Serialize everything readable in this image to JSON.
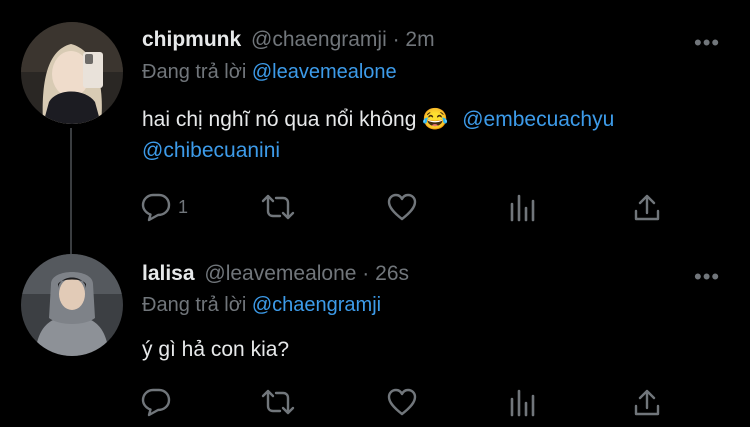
{
  "tweets": [
    {
      "name": "chipmunk",
      "handle": "@chaengramji",
      "time_sep": " · ",
      "time": "2m",
      "reply_prefix": "Đang trả lời ",
      "reply_to": "@leavemealone",
      "text": "hai chị nghĩ nó qua nổi không 😂",
      "mention_1": "@embecuachyu",
      "mention_2": "@chibecuanini",
      "reply_count": "1",
      "more": "•••"
    },
    {
      "name": "lalisa",
      "handle": "@leavemealone",
      "time_sep": " · ",
      "time": "26s",
      "reply_prefix": "Đang trả lời ",
      "reply_to": "@chaengramji",
      "text": "ý gì hả con kia?",
      "more": "•••"
    }
  ],
  "colors": {
    "background": "#000000",
    "text": "#e7e9ea",
    "muted": "#71767b",
    "mention": "#3d9be9"
  },
  "icons": [
    "reply-icon",
    "retweet-icon",
    "like-icon",
    "analytics-icon",
    "share-icon",
    "more-icon"
  ]
}
